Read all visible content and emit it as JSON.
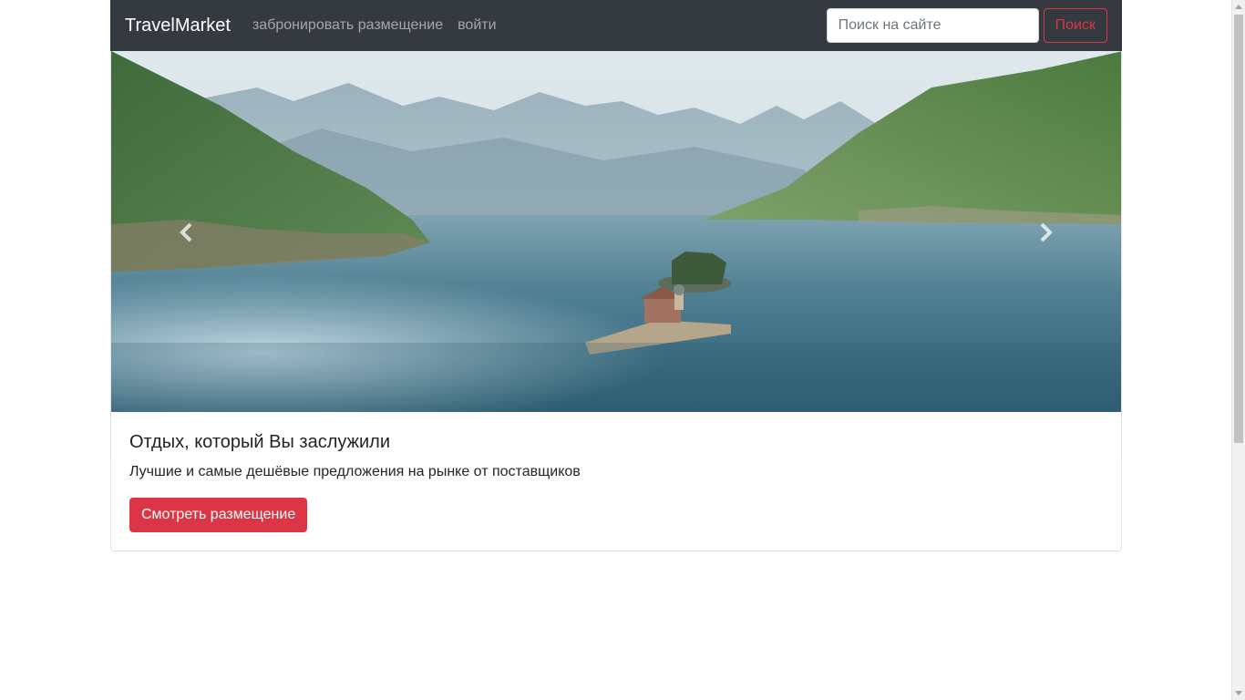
{
  "navbar": {
    "brand": "TravelMarket",
    "links": [
      "забронировать размещение",
      "войти"
    ],
    "search_placeholder": "Поиск на сайте",
    "search_button": "Поиск"
  },
  "hero": {
    "image_description_icon": "lake-mountains-photo",
    "prev_icon": "chevron-left-icon",
    "next_icon": "chevron-right-icon"
  },
  "card": {
    "title": "Отдых, который Вы заслужили",
    "text": "Лучшие и самые дешёвые предложения на рынке от поставщиков",
    "button": "Смотреть размещение"
  },
  "colors": {
    "navbar_bg": "#343a40",
    "accent": "#dc3545"
  }
}
